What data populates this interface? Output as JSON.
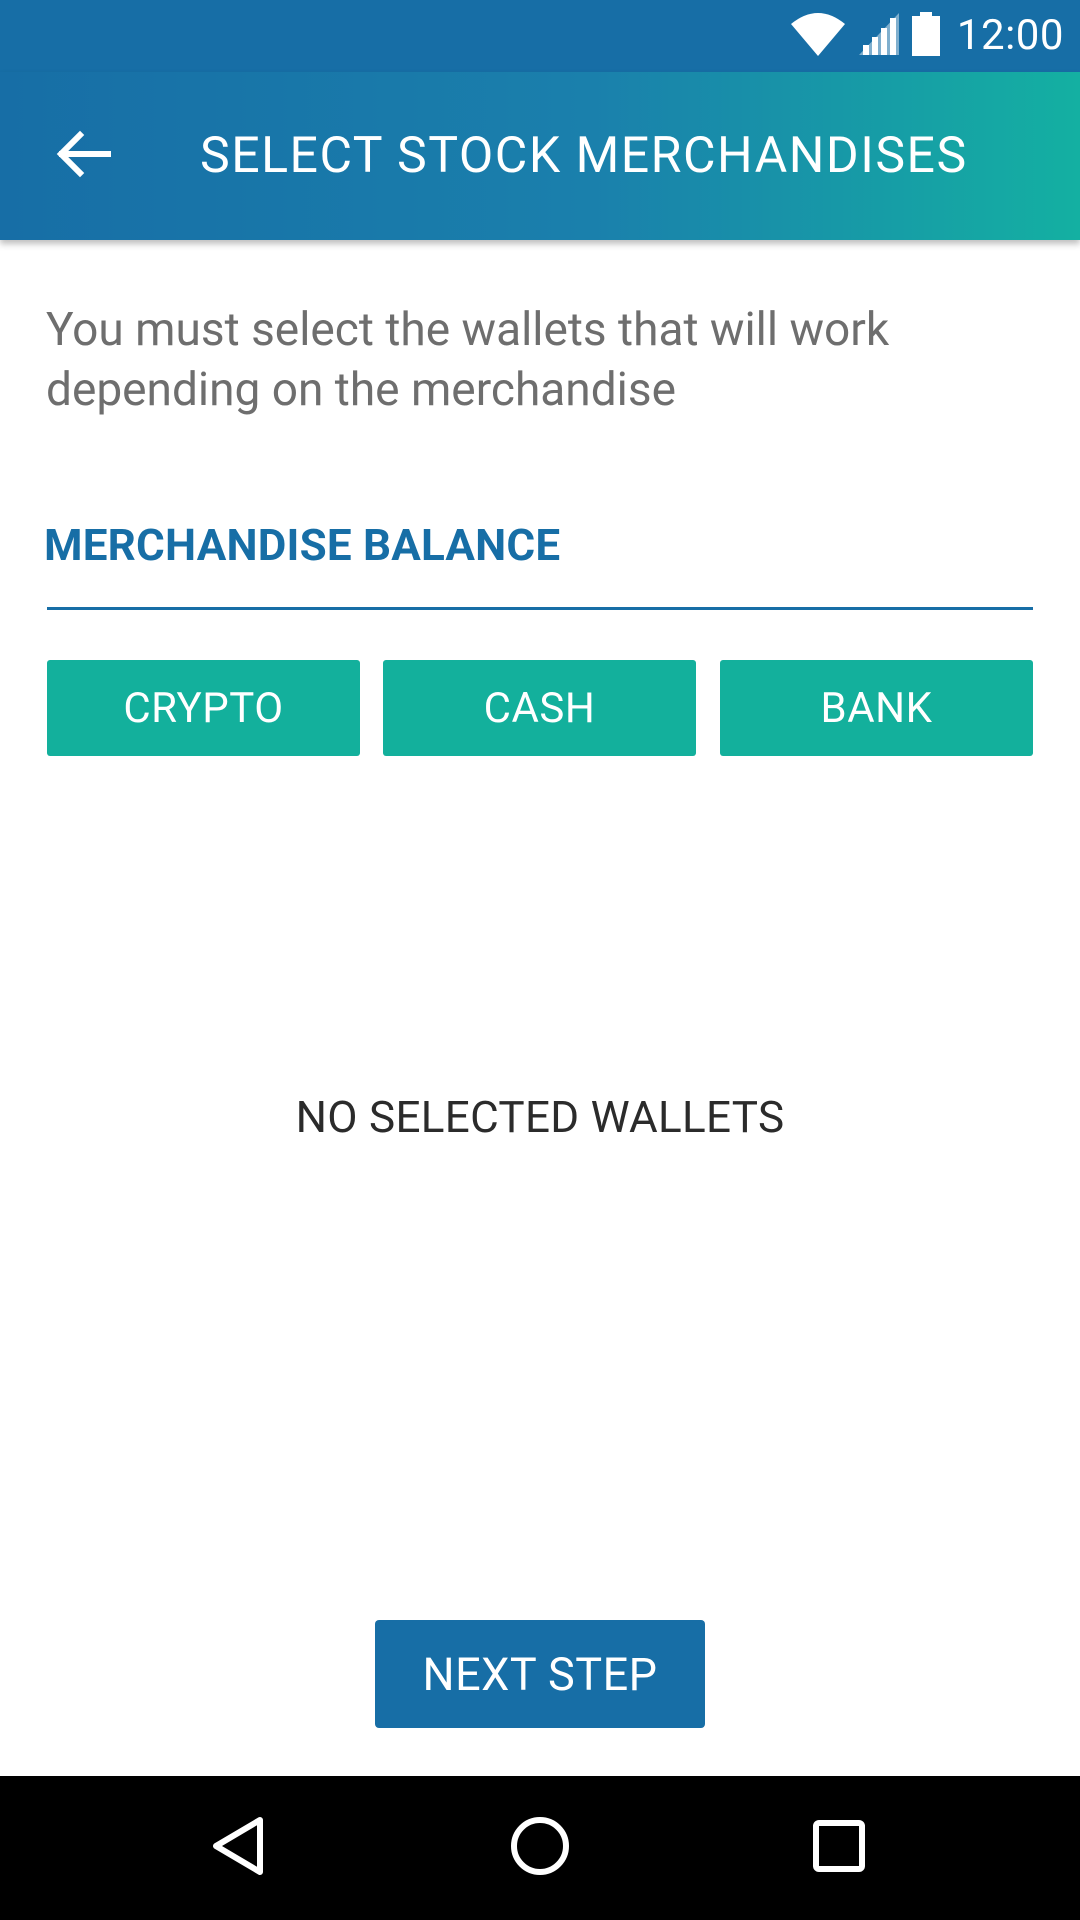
{
  "status_bar": {
    "time": "12:00",
    "icons": [
      "wifi-icon",
      "signal-icon",
      "battery-icon"
    ]
  },
  "app_bar": {
    "back_icon": "arrow-left-icon",
    "title": "SELECT STOCK MERCHANDISES"
  },
  "content": {
    "intro_text": "You must select the wallets that will work depending on the merchandise",
    "section_label": "MERCHANDISE BALANCE",
    "wallet_buttons": [
      {
        "label": "CRYPTO"
      },
      {
        "label": "CASH"
      },
      {
        "label": "BANK"
      }
    ],
    "empty_state": "NO SELECTED WALLETS",
    "next_button_label": "NEXT STEP"
  },
  "nav_bar": {
    "icons": [
      "back-triangle-icon",
      "home-circle-icon",
      "recents-square-icon"
    ]
  },
  "colors": {
    "primary": "#176ea6",
    "accent": "#13b09c",
    "status_bar": "#176ea6",
    "text_secondary": "#6e6e6e",
    "nav_bar": "#000000"
  }
}
